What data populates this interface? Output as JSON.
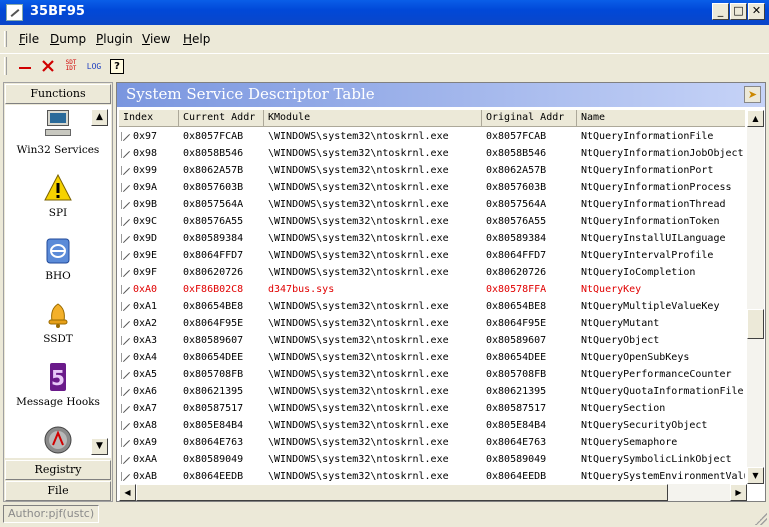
{
  "window": {
    "title": "35BF95"
  },
  "menu": [
    "File",
    "Dump",
    "Plugin",
    "View",
    "Help"
  ],
  "menu_underline": [
    "F",
    "D",
    "P",
    "V",
    "H"
  ],
  "toolbar": {
    "sdt_idt_label_top": "SDT",
    "sdt_idt_label_bottom": "IDT",
    "log_label": "LOG",
    "help_label": "?"
  },
  "left_panel": {
    "header": "Functions",
    "items": [
      {
        "label": "Win32 Services",
        "icon": "computer-icon"
      },
      {
        "label": "SPI",
        "icon": "warning-icon"
      },
      {
        "label": "BHO",
        "icon": "ie-icon"
      },
      {
        "label": "SSDT",
        "icon": "bell-icon"
      },
      {
        "label": "Message Hooks",
        "icon": "hook-five-icon"
      },
      {
        "label": "",
        "icon": "disc-icon"
      }
    ],
    "footer_tabs": [
      "Registry",
      "File"
    ]
  },
  "ssdt": {
    "title": "System Service Descriptor Table",
    "columns": [
      "Index",
      "Current Addr",
      "KModule",
      "Original Addr",
      "Name"
    ],
    "rows": [
      [
        "0x97",
        "0x8057FCAB",
        "\\WINDOWS\\system32\\ntoskrnl.exe",
        "0x8057FCAB",
        "NtQueryInformationFile"
      ],
      [
        "0x98",
        "0x8058B546",
        "\\WINDOWS\\system32\\ntoskrnl.exe",
        "0x8058B546",
        "NtQueryInformationJobObject"
      ],
      [
        "0x99",
        "0x8062A57B",
        "\\WINDOWS\\system32\\ntoskrnl.exe",
        "0x8062A57B",
        "NtQueryInformationPort"
      ],
      [
        "0x9A",
        "0x8057603B",
        "\\WINDOWS\\system32\\ntoskrnl.exe",
        "0x8057603B",
        "NtQueryInformationProcess"
      ],
      [
        "0x9B",
        "0x8057564A",
        "\\WINDOWS\\system32\\ntoskrnl.exe",
        "0x8057564A",
        "NtQueryInformationThread"
      ],
      [
        "0x9C",
        "0x80576A55",
        "\\WINDOWS\\system32\\ntoskrnl.exe",
        "0x80576A55",
        "NtQueryInformationToken"
      ],
      [
        "0x9D",
        "0x80589384",
        "\\WINDOWS\\system32\\ntoskrnl.exe",
        "0x80589384",
        "NtQueryInstallUILanguage"
      ],
      [
        "0x9E",
        "0x8064FFD7",
        "\\WINDOWS\\system32\\ntoskrnl.exe",
        "0x8064FFD7",
        "NtQueryIntervalProfile"
      ],
      [
        "0x9F",
        "0x80620726",
        "\\WINDOWS\\system32\\ntoskrnl.exe",
        "0x80620726",
        "NtQueryIoCompletion"
      ],
      [
        "0xA0",
        "0xF86B02C8",
        "d347bus.sys",
        "0x80578FFA",
        "NtQueryKey"
      ],
      [
        "0xA1",
        "0x80654BE8",
        "\\WINDOWS\\system32\\ntoskrnl.exe",
        "0x80654BE8",
        "NtQueryMultipleValueKey"
      ],
      [
        "0xA2",
        "0x8064F95E",
        "\\WINDOWS\\system32\\ntoskrnl.exe",
        "0x8064F95E",
        "NtQueryMutant"
      ],
      [
        "0xA3",
        "0x80589607",
        "\\WINDOWS\\system32\\ntoskrnl.exe",
        "0x80589607",
        "NtQueryObject"
      ],
      [
        "0xA4",
        "0x80654DEE",
        "\\WINDOWS\\system32\\ntoskrnl.exe",
        "0x80654DEE",
        "NtQueryOpenSubKeys"
      ],
      [
        "0xA5",
        "0x805708FB",
        "\\WINDOWS\\system32\\ntoskrnl.exe",
        "0x805708FB",
        "NtQueryPerformanceCounter"
      ],
      [
        "0xA6",
        "0x80621395",
        "\\WINDOWS\\system32\\ntoskrnl.exe",
        "0x80621395",
        "NtQueryQuotaInformationFile"
      ],
      [
        "0xA7",
        "0x80587517",
        "\\WINDOWS\\system32\\ntoskrnl.exe",
        "0x80587517",
        "NtQuerySection"
      ],
      [
        "0xA8",
        "0x805E84B4",
        "\\WINDOWS\\system32\\ntoskrnl.exe",
        "0x805E84B4",
        "NtQuerySecurityObject"
      ],
      [
        "0xA9",
        "0x8064E763",
        "\\WINDOWS\\system32\\ntoskrnl.exe",
        "0x8064E763",
        "NtQuerySemaphore"
      ],
      [
        "0xAA",
        "0x80589049",
        "\\WINDOWS\\system32\\ntoskrnl.exe",
        "0x80589049",
        "NtQuerySymbolicLinkObject"
      ],
      [
        "0xAB",
        "0x8064EEDB",
        "\\WINDOWS\\system32\\ntoskrnl.exe",
        "0x8064EEDB",
        "NtQuerySystemEnvironmentValue"
      ]
    ],
    "highlight_row_index": 9,
    "highlight_color": "#e00000"
  },
  "status": {
    "author": "Author:pjf(ustc)"
  }
}
